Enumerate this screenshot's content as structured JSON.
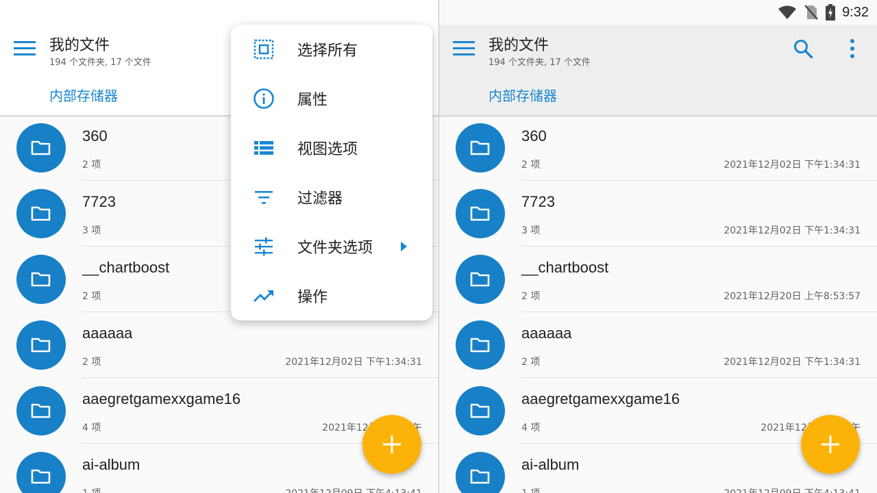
{
  "status": {
    "time": "9:32"
  },
  "header": {
    "title": "我的文件",
    "subtitle": "194 个文件夹, 17 个文件",
    "breadcrumb": "内部存储器"
  },
  "colors": {
    "accent": "#1a86d0",
    "folder": "#1780c6",
    "fab": "#fbb30a"
  },
  "left_files": [
    {
      "name": "360",
      "count": "2 项",
      "date": ""
    },
    {
      "name": "7723",
      "count": "3 项",
      "date": ""
    },
    {
      "name": "__chartboost",
      "count": "2 项",
      "date": ""
    },
    {
      "name": "aaaaaa",
      "count": "2 项",
      "date": "2021年12月02日 下午1:34:31"
    },
    {
      "name": "aaegretgamexxgame16",
      "count": "4 项",
      "date": "2021年12月06日 下午"
    },
    {
      "name": "ai-album",
      "count": "1 项",
      "date": "2021年12月09日 下午4:13:41"
    }
  ],
  "right_files": [
    {
      "name": "360",
      "count": "2 项",
      "date": "2021年12月02日 下午1:34:31"
    },
    {
      "name": "7723",
      "count": "3 项",
      "date": "2021年12月02日 下午1:34:31"
    },
    {
      "name": "__chartboost",
      "count": "2 项",
      "date": "2021年12月20日 上午8:53:57"
    },
    {
      "name": "aaaaaa",
      "count": "2 项",
      "date": "2021年12月02日 下午1:34:31"
    },
    {
      "name": "aaegretgamexxgame16",
      "count": "4 项",
      "date": "2021年12月06日 下午"
    },
    {
      "name": "ai-album",
      "count": "1 项",
      "date": "2021年12月09日 下午4:13:41"
    }
  ],
  "menu": [
    {
      "label": "选择所有",
      "icon": "select-all-icon"
    },
    {
      "label": "属性",
      "icon": "info-icon"
    },
    {
      "label": "视图选项",
      "icon": "view-list-icon"
    },
    {
      "label": "过滤器",
      "icon": "filter-icon"
    },
    {
      "label": "文件夹选项",
      "icon": "tune-icon",
      "submenu": true
    },
    {
      "label": "操作",
      "icon": "trending-icon"
    }
  ]
}
